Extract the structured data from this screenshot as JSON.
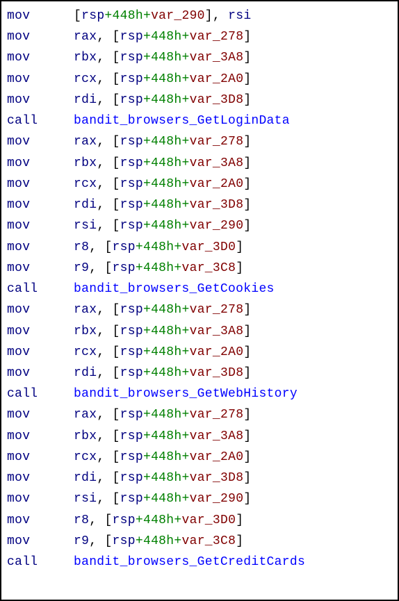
{
  "lines": [
    {
      "mnemonic": "mov",
      "op": {
        "type": "mem_store",
        "base": "rsp",
        "offset": "448h",
        "var": "var_290",
        "src": "rsi"
      }
    },
    {
      "mnemonic": "mov",
      "op": {
        "type": "mem_load",
        "dest": "rax",
        "base": "rsp",
        "offset": "448h",
        "var": "var_278"
      }
    },
    {
      "mnemonic": "mov",
      "op": {
        "type": "mem_load",
        "dest": "rbx",
        "base": "rsp",
        "offset": "448h",
        "var": "var_3A8"
      }
    },
    {
      "mnemonic": "mov",
      "op": {
        "type": "mem_load",
        "dest": "rcx",
        "base": "rsp",
        "offset": "448h",
        "var": "var_2A0"
      }
    },
    {
      "mnemonic": "mov",
      "op": {
        "type": "mem_load",
        "dest": "rdi",
        "base": "rsp",
        "offset": "448h",
        "var": "var_3D8"
      }
    },
    {
      "mnemonic": "call",
      "op": {
        "type": "call",
        "target": "bandit_browsers_GetLoginData"
      }
    },
    {
      "mnemonic": "mov",
      "op": {
        "type": "mem_load",
        "dest": "rax",
        "base": "rsp",
        "offset": "448h",
        "var": "var_278"
      }
    },
    {
      "mnemonic": "mov",
      "op": {
        "type": "mem_load",
        "dest": "rbx",
        "base": "rsp",
        "offset": "448h",
        "var": "var_3A8"
      }
    },
    {
      "mnemonic": "mov",
      "op": {
        "type": "mem_load",
        "dest": "rcx",
        "base": "rsp",
        "offset": "448h",
        "var": "var_2A0"
      }
    },
    {
      "mnemonic": "mov",
      "op": {
        "type": "mem_load",
        "dest": "rdi",
        "base": "rsp",
        "offset": "448h",
        "var": "var_3D8"
      }
    },
    {
      "mnemonic": "mov",
      "op": {
        "type": "mem_load",
        "dest": "rsi",
        "base": "rsp",
        "offset": "448h",
        "var": "var_290"
      }
    },
    {
      "mnemonic": "mov",
      "op": {
        "type": "mem_load",
        "dest": "r8",
        "base": "rsp",
        "offset": "448h",
        "var": "var_3D0"
      }
    },
    {
      "mnemonic": "mov",
      "op": {
        "type": "mem_load",
        "dest": "r9",
        "base": "rsp",
        "offset": "448h",
        "var": "var_3C8"
      }
    },
    {
      "mnemonic": "call",
      "op": {
        "type": "call",
        "target": "bandit_browsers_GetCookies"
      }
    },
    {
      "mnemonic": "mov",
      "op": {
        "type": "mem_load",
        "dest": "rax",
        "base": "rsp",
        "offset": "448h",
        "var": "var_278"
      }
    },
    {
      "mnemonic": "mov",
      "op": {
        "type": "mem_load",
        "dest": "rbx",
        "base": "rsp",
        "offset": "448h",
        "var": "var_3A8"
      }
    },
    {
      "mnemonic": "mov",
      "op": {
        "type": "mem_load",
        "dest": "rcx",
        "base": "rsp",
        "offset": "448h",
        "var": "var_2A0"
      }
    },
    {
      "mnemonic": "mov",
      "op": {
        "type": "mem_load",
        "dest": "rdi",
        "base": "rsp",
        "offset": "448h",
        "var": "var_3D8"
      }
    },
    {
      "mnemonic": "call",
      "op": {
        "type": "call",
        "target": "bandit_browsers_GetWebHistory"
      }
    },
    {
      "mnemonic": "mov",
      "op": {
        "type": "mem_load",
        "dest": "rax",
        "base": "rsp",
        "offset": "448h",
        "var": "var_278"
      }
    },
    {
      "mnemonic": "mov",
      "op": {
        "type": "mem_load",
        "dest": "rbx",
        "base": "rsp",
        "offset": "448h",
        "var": "var_3A8"
      }
    },
    {
      "mnemonic": "mov",
      "op": {
        "type": "mem_load",
        "dest": "rcx",
        "base": "rsp",
        "offset": "448h",
        "var": "var_2A0"
      }
    },
    {
      "mnemonic": "mov",
      "op": {
        "type": "mem_load",
        "dest": "rdi",
        "base": "rsp",
        "offset": "448h",
        "var": "var_3D8"
      }
    },
    {
      "mnemonic": "mov",
      "op": {
        "type": "mem_load",
        "dest": "rsi",
        "base": "rsp",
        "offset": "448h",
        "var": "var_290"
      }
    },
    {
      "mnemonic": "mov",
      "op": {
        "type": "mem_load",
        "dest": "r8",
        "base": "rsp",
        "offset": "448h",
        "var": "var_3D0"
      }
    },
    {
      "mnemonic": "mov",
      "op": {
        "type": "mem_load",
        "dest": "r9",
        "base": "rsp",
        "offset": "448h",
        "var": "var_3C8"
      }
    },
    {
      "mnemonic": "call",
      "op": {
        "type": "call",
        "target": "bandit_browsers_GetCreditCards"
      }
    }
  ]
}
